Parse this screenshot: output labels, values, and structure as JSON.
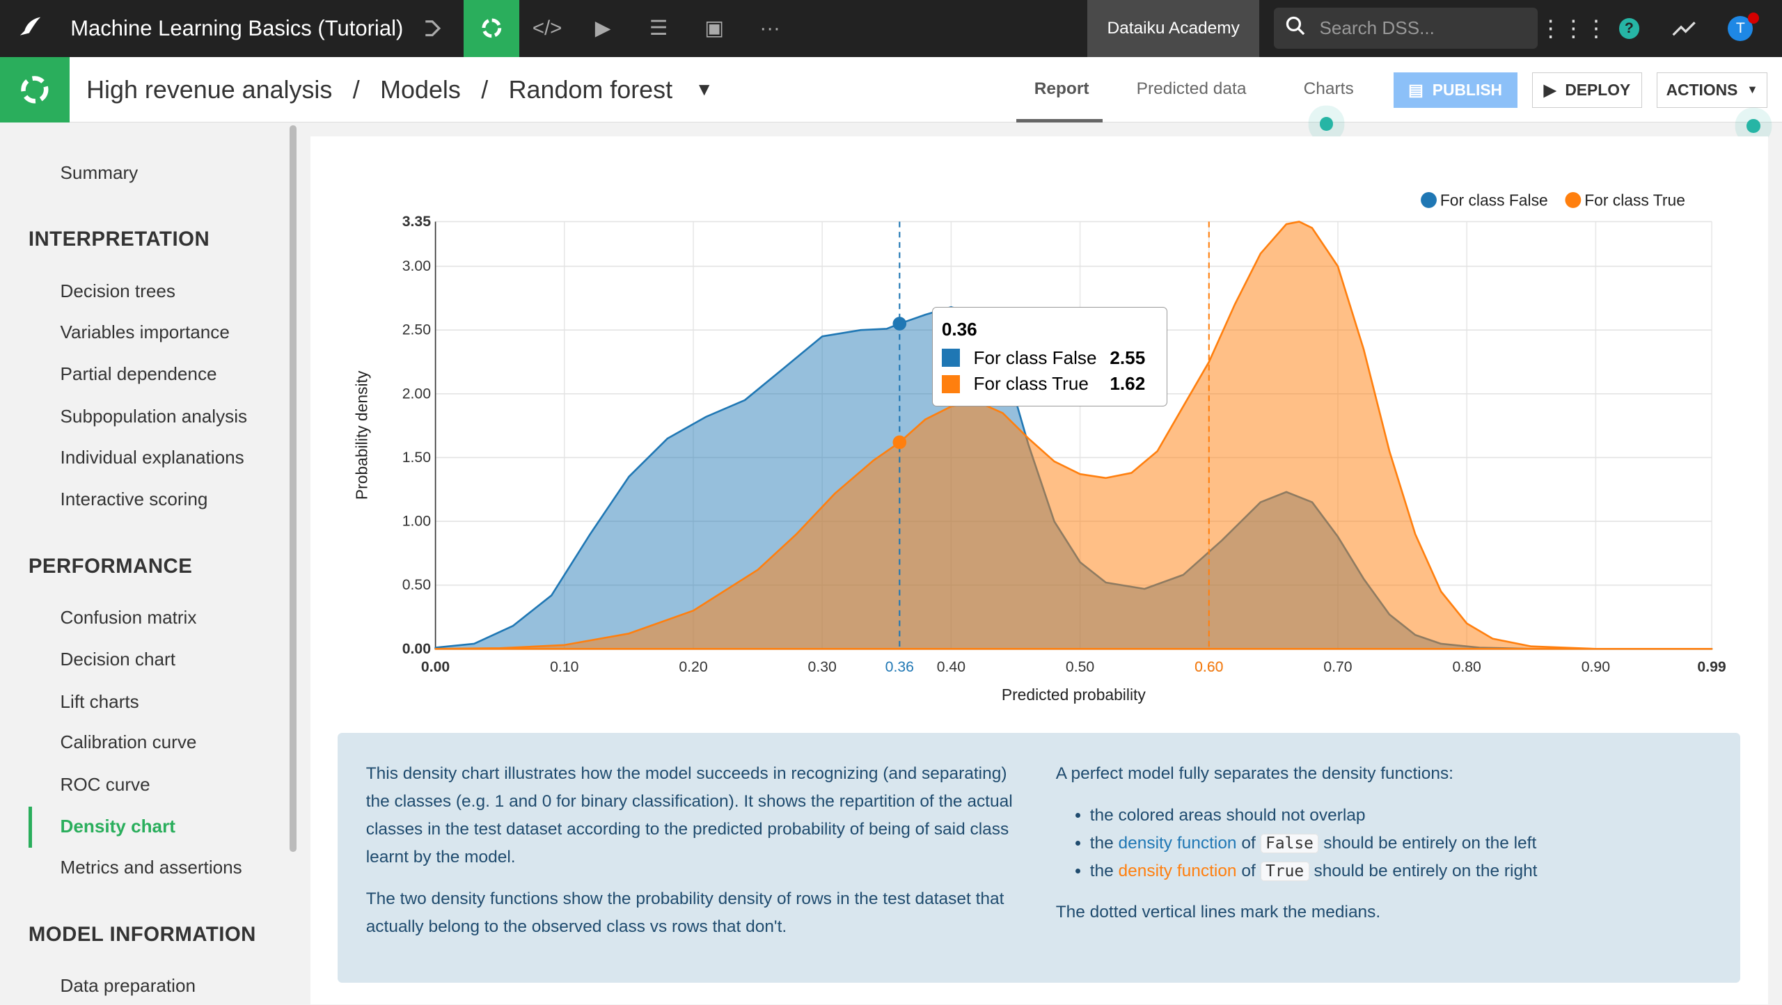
{
  "topbar": {
    "app_title": "Machine Learning Basics (Tutorial)",
    "academy": "Dataiku Academy",
    "search_placeholder": "Search DSS...",
    "avatar_initial": "T",
    "colors": {
      "active": "#2aae5c",
      "help": "#26b5a5",
      "avatar": "#1e88e5",
      "notification": "#d50000"
    }
  },
  "breadcrumb": [
    "High revenue analysis",
    "/",
    "Models",
    "/",
    "Random forest"
  ],
  "tabs": [
    {
      "label": "Report",
      "active": true
    },
    {
      "label": "Predicted data"
    },
    {
      "label": "Charts"
    }
  ],
  "buttons": {
    "publish": "PUBLISH",
    "deploy": "DEPLOY",
    "actions": "ACTIONS"
  },
  "sidebar": {
    "summary": "Summary",
    "sections": [
      {
        "title": "INTERPRETATION",
        "items": [
          "Decision trees",
          "Variables importance",
          "Partial dependence",
          "Subpopulation analysis",
          "Individual explanations",
          "Interactive scoring"
        ]
      },
      {
        "title": "PERFORMANCE",
        "items": [
          "Confusion matrix",
          "Decision chart",
          "Lift charts",
          "Calibration curve",
          "ROC curve",
          "Density chart",
          "Metrics and assertions"
        ]
      },
      {
        "title": "MODEL INFORMATION",
        "items": [
          "Data preparation"
        ]
      }
    ],
    "active": "Density chart"
  },
  "chart_data": {
    "type": "area",
    "xlabel": "Predicted probability",
    "ylabel": "Probability density",
    "xlim": [
      0,
      0.99
    ],
    "ylim": [
      0,
      3.35
    ],
    "x_ticks": [
      "0.00",
      "0.10",
      "0.20",
      "0.30",
      "0.40",
      "0.50",
      "0.60",
      "0.70",
      "0.80",
      "0.90",
      "0.99"
    ],
    "y_ticks": [
      "0.00",
      "0.50",
      "1.00",
      "1.50",
      "2.00",
      "2.50",
      "3.00",
      "3.35"
    ],
    "legend": "top-right",
    "grid": true,
    "series": [
      {
        "name": "For class False",
        "color": "#1f77b4",
        "median": 0.36,
        "median_label": "0.36",
        "points": [
          [
            0,
            0.01
          ],
          [
            0.03,
            0.04
          ],
          [
            0.06,
            0.18
          ],
          [
            0.09,
            0.42
          ],
          [
            0.12,
            0.9
          ],
          [
            0.15,
            1.35
          ],
          [
            0.18,
            1.65
          ],
          [
            0.21,
            1.82
          ],
          [
            0.24,
            1.95
          ],
          [
            0.27,
            2.2
          ],
          [
            0.3,
            2.45
          ],
          [
            0.33,
            2.5
          ],
          [
            0.35,
            2.51
          ],
          [
            0.36,
            2.55
          ],
          [
            0.38,
            2.62
          ],
          [
            0.4,
            2.68
          ],
          [
            0.42,
            2.62
          ],
          [
            0.44,
            2.3
          ],
          [
            0.46,
            1.6
          ],
          [
            0.48,
            1.0
          ],
          [
            0.5,
            0.68
          ],
          [
            0.52,
            0.52
          ],
          [
            0.55,
            0.47
          ],
          [
            0.58,
            0.58
          ],
          [
            0.61,
            0.85
          ],
          [
            0.64,
            1.15
          ],
          [
            0.66,
            1.23
          ],
          [
            0.68,
            1.15
          ],
          [
            0.7,
            0.88
          ],
          [
            0.72,
            0.55
          ],
          [
            0.74,
            0.27
          ],
          [
            0.76,
            0.11
          ],
          [
            0.78,
            0.04
          ],
          [
            0.81,
            0.01
          ],
          [
            0.85,
            0
          ],
          [
            0.99,
            0
          ]
        ]
      },
      {
        "name": "For class True",
        "color": "#ff7f0e",
        "median": 0.6,
        "median_label": "0.60",
        "points": [
          [
            0,
            0
          ],
          [
            0.05,
            0.005
          ],
          [
            0.1,
            0.03
          ],
          [
            0.15,
            0.12
          ],
          [
            0.2,
            0.3
          ],
          [
            0.25,
            0.62
          ],
          [
            0.28,
            0.9
          ],
          [
            0.31,
            1.22
          ],
          [
            0.34,
            1.48
          ],
          [
            0.36,
            1.62
          ],
          [
            0.38,
            1.8
          ],
          [
            0.4,
            1.9
          ],
          [
            0.42,
            1.94
          ],
          [
            0.44,
            1.85
          ],
          [
            0.46,
            1.65
          ],
          [
            0.48,
            1.47
          ],
          [
            0.5,
            1.37
          ],
          [
            0.52,
            1.34
          ],
          [
            0.54,
            1.38
          ],
          [
            0.56,
            1.55
          ],
          [
            0.58,
            1.9
          ],
          [
            0.6,
            2.25
          ],
          [
            0.62,
            2.7
          ],
          [
            0.64,
            3.1
          ],
          [
            0.66,
            3.33
          ],
          [
            0.67,
            3.35
          ],
          [
            0.68,
            3.3
          ],
          [
            0.7,
            3.0
          ],
          [
            0.72,
            2.35
          ],
          [
            0.74,
            1.55
          ],
          [
            0.76,
            0.9
          ],
          [
            0.78,
            0.45
          ],
          [
            0.8,
            0.2
          ],
          [
            0.82,
            0.08
          ],
          [
            0.85,
            0.02
          ],
          [
            0.9,
            0
          ],
          [
            0.99,
            0
          ]
        ]
      }
    ],
    "tooltip": {
      "x": "0.36",
      "rows": [
        {
          "label": "For class False",
          "value": "2.55"
        },
        {
          "label": "For class True",
          "value": "1.62"
        }
      ]
    }
  },
  "info": {
    "left_p1": "This density chart illustrates how the model succeeds in recognizing (and separating) the classes (e.g. 1 and 0 for binary classification). It shows the repartition of the actual classes in the test dataset according to the predicted probability of being of said class learnt by the model.",
    "left_p2": "The two density functions show the probability density of rows in the test dataset that actually belong to the observed class vs rows that don't.",
    "right_intro": "A perfect model fully separates the density functions:",
    "bullet1": "the colored areas should not overlap",
    "the": "the",
    "density_function": "density function",
    "of": "of",
    "false_code": "False",
    "false_tail": "should be entirely on the left",
    "true_code": "True",
    "true_tail": "should be entirely on the right",
    "right_outro": "The dotted vertical lines mark the medians."
  }
}
